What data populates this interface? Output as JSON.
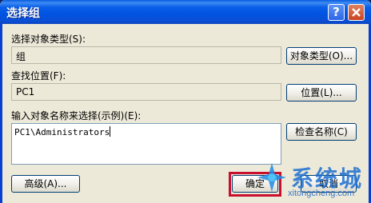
{
  "window": {
    "title": "选择组"
  },
  "titlebar": {
    "help_glyph": "?",
    "close_glyph": "✕"
  },
  "object_type": {
    "label": "选择对象类型(S):",
    "value": "组",
    "button": "对象类型(O)..."
  },
  "location": {
    "label": "查找位置(F):",
    "value": "PC1",
    "button": "位置(L)..."
  },
  "object_names": {
    "label": "输入对象名称来选择(示例)(E):",
    "value": "PC1\\Administrators",
    "check_button": "检查名称(C)"
  },
  "footer": {
    "advanced_button": "高级(A)...",
    "ok_button": "确定",
    "cancel_button": "取消"
  },
  "watermark": {
    "text": "系统城",
    "url": "xitongcheng.com"
  }
}
